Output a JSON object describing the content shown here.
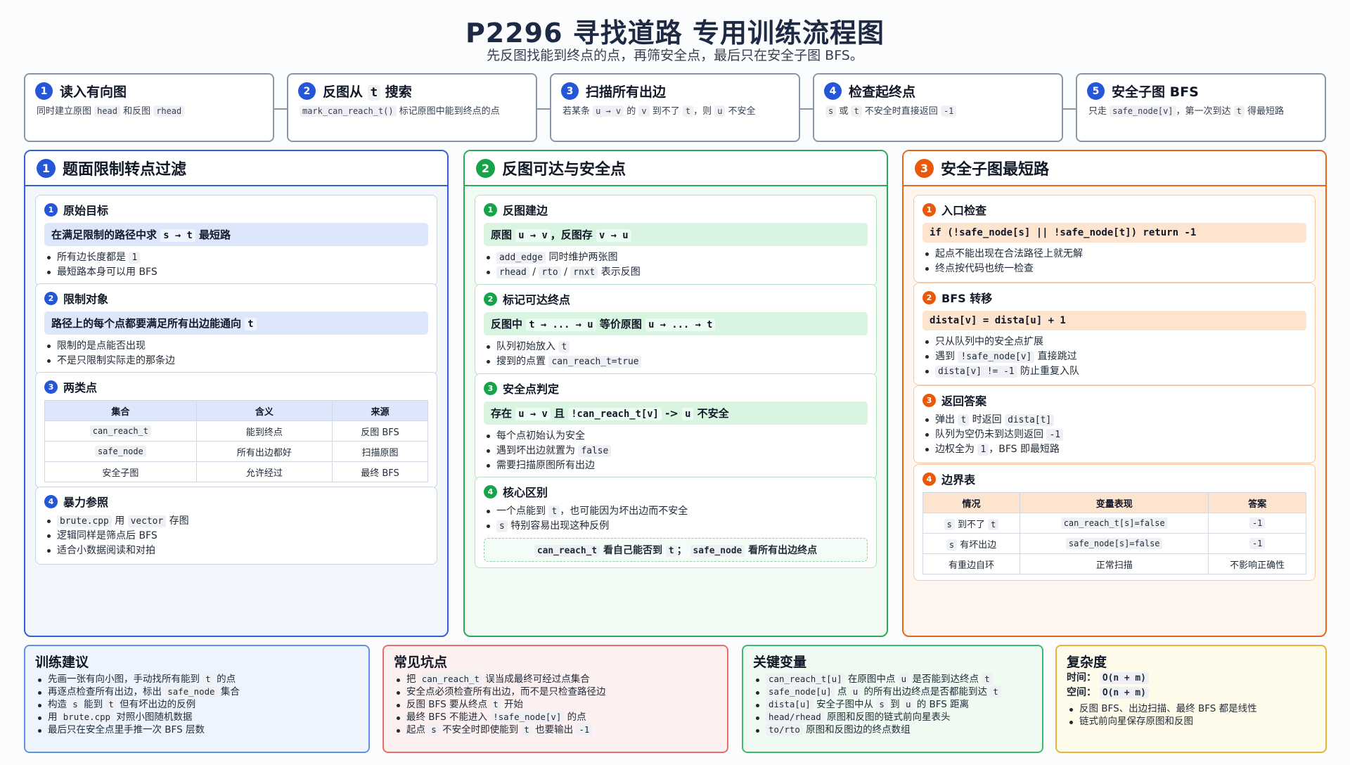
{
  "header": {
    "title": "P2296 寻找道路 专用训练流程图",
    "subtitle": "先反图找能到终点的点，再筛安全点，最后只在安全子图 BFS。"
  },
  "steps": [
    {
      "num": "1",
      "title": "读入有向图",
      "desc_html": "同时建立原图 <code>head</code> 和反图 <code>rhead</code>"
    },
    {
      "num": "2",
      "title_html": "反图从 <code>t</code> 搜索",
      "desc_html": "<code>mark_can_reach_t()</code> 标记原图中能到终点的点"
    },
    {
      "num": "3",
      "title": "扫描所有出边",
      "desc_html": "若某条 <code>u → v</code> 的 <code>v</code> 到不了 <code>t</code>，则 <code>u</code> 不安全"
    },
    {
      "num": "4",
      "title": "检查起终点",
      "desc_html": "<code>s</code> 或 <code>t</code> 不安全时直接返回 <code>-1</code>"
    },
    {
      "num": "5",
      "title": "安全子图 BFS",
      "desc_html": "只走 <code>safe_node[v]</code>，第一次到达 <code>t</code> 得最短路"
    }
  ],
  "panels": {
    "p1": {
      "num": "1",
      "title": "题面限制转点过滤",
      "c1": {
        "num": "1",
        "title": "原始目标",
        "hl_html": "在满足限制的路径中求 <code>s → t</code> 最短路",
        "items_html": [
          "所有边长度都是 <code>1</code>",
          "最短路本身可以用 BFS"
        ]
      },
      "c2": {
        "num": "2",
        "title": "限制对象",
        "hl_html": "路径上的每个点都要满足所有出边能通向 <code>t</code>",
        "items_html": [
          "限制的是点能否出现",
          "不是只限制实际走的那条边"
        ]
      },
      "c3": {
        "num": "3",
        "title": "两类点",
        "headers": [
          "集合",
          "含义",
          "来源"
        ],
        "rows": [
          [
            "can_reach_t",
            "能到终点",
            "反图 BFS"
          ],
          [
            "safe_node",
            "所有出边都好",
            "扫描原图"
          ],
          [
            "安全子图",
            "允许经过",
            "最终 BFS"
          ]
        ]
      },
      "c4": {
        "num": "4",
        "title": "暴力参照",
        "items_html": [
          "<code>brute.cpp</code> 用 <code>vector</code> 存图",
          "逻辑同样是筛点后 BFS",
          "适合小数据阅读和对拍"
        ]
      }
    },
    "p2": {
      "num": "2",
      "title": "反图可达与安全点",
      "c1": {
        "num": "1",
        "title": "反图建边",
        "hl_html": "原图 <code>u → v</code>，反图存 <code>v → u</code>",
        "items_html": [
          "<code>add_edge</code> 同时维护两张图",
          "<code>rhead</code> / <code>rto</code> / <code>rnxt</code> 表示反图"
        ]
      },
      "c2": {
        "num": "2",
        "title": "标记可达终点",
        "hl_html": "反图中 <code>t → ... → u</code> 等价原图 <code>u → ... → t</code>",
        "items_html": [
          "队列初始放入 <code>t</code>",
          "搜到的点置 <code>can_reach_t=true</code>"
        ]
      },
      "c3": {
        "num": "3",
        "title": "安全点判定",
        "hl_html": "存在 <code>u → v</code> 且 <code>!can_reach_t[v]</code> -> <code>u</code> 不安全",
        "items_html": [
          "每个点初始认为安全",
          "遇到坏出边就置为 <code>false</code>",
          "需要扫描原图所有出边"
        ]
      },
      "c4": {
        "num": "4",
        "title": "核心区别",
        "items_html": [
          "一个点能到 <code>t</code>，也可能因为坏出边而不安全",
          "<code>s</code> 特别容易出现这种反例"
        ],
        "note_html": "<code>can_reach_t</code> 看自己能否到 <code>t</code>； <code>safe_node</code> 看所有出边终点"
      }
    },
    "p3": {
      "num": "3",
      "title": "安全子图最短路",
      "c1": {
        "num": "1",
        "title": "入口检查",
        "hl_code": "if (!safe_node[s] || !safe_node[t]) return -1",
        "items_html": [
          "起点不能出现在合法路径上就无解",
          "终点按代码也统一检查"
        ]
      },
      "c2": {
        "num": "2",
        "title": "BFS 转移",
        "hl_code": "dista[v] = dista[u] + 1",
        "items_html": [
          "只从队列中的安全点扩展",
          "遇到 <code>!safe_node[v]</code> 直接跳过",
          "<code>dista[v] != -1</code> 防止重复入队"
        ]
      },
      "c3": {
        "num": "3",
        "title": "返回答案",
        "items_html": [
          "弹出 <code>t</code> 时返回 <code>dista[t]</code>",
          "队列为空仍未到达则返回 <code>-1</code>",
          "边权全为 <code>1</code>，BFS 即最短路"
        ]
      },
      "c4": {
        "num": "4",
        "title": "边界表",
        "headers": [
          "情况",
          "变量表现",
          "答案"
        ],
        "rows_html": [
          [
            "<code>s</code> 到不了 <code>t</code>",
            "<code>can_reach_t[s]=false</code>",
            "<code>-1</code>"
          ],
          [
            "<code>s</code> 有坏出边",
            "<code>safe_node[s]=false</code>",
            "<code>-1</code>"
          ],
          [
            "有重边自环",
            "正常扫描",
            "不影响正确性"
          ]
        ]
      }
    }
  },
  "bottom": {
    "b1": {
      "title": "训练建议",
      "items_html": [
        "先画一张有向小图，手动找所有能到 <code>t</code> 的点",
        "再逐点检查所有出边，标出 <code>safe_node</code> 集合",
        "构造 <code>s</code> 能到 <code>t</code> 但有坏出边的反例",
        "用 <code>brute.cpp</code> 对照小图随机数据",
        "最后只在安全点里手推一次 BFS 层数"
      ]
    },
    "b2": {
      "title": "常见坑点",
      "items_html": [
        "把 <code>can_reach_t</code> 误当成最终可经过点集合",
        "安全点必须检查所有出边，而不是只检查路径边",
        "反图 BFS 要从终点 <code>t</code> 开始",
        "最终 BFS 不能进入 <code>!safe_node[v]</code> 的点",
        "起点 <code>s</code> 不安全时即使能到 <code>t</code> 也要输出 <code>-1</code>"
      ]
    },
    "b3": {
      "title": "关键变量",
      "items_html": [
        "<code>can_reach_t[u]</code> 在原图中点 <code>u</code> 是否能到达终点 <code>t</code>",
        "<code>safe_node[u]</code> 点 <code>u</code> 的所有出边终点是否都能到达 <code>t</code>",
        "<code>dista[u]</code> 安全子图中从 <code>s</code> 到 <code>u</code> 的 BFS 距离",
        "<code>head/rhead</code> 原图和反图的链式前向星表头",
        "<code>to/rto</code> 原图和反图边的终点数组"
      ]
    },
    "b4": {
      "title": "复杂度",
      "time_label": "时间：",
      "time_val": "O(n + m)",
      "space_label": "空间：",
      "space_val": "O(n + m)",
      "items_html": [
        "反图 BFS、出边扫描、最终 BFS 都是线性",
        "链式前向星保存原图和反图"
      ]
    }
  }
}
